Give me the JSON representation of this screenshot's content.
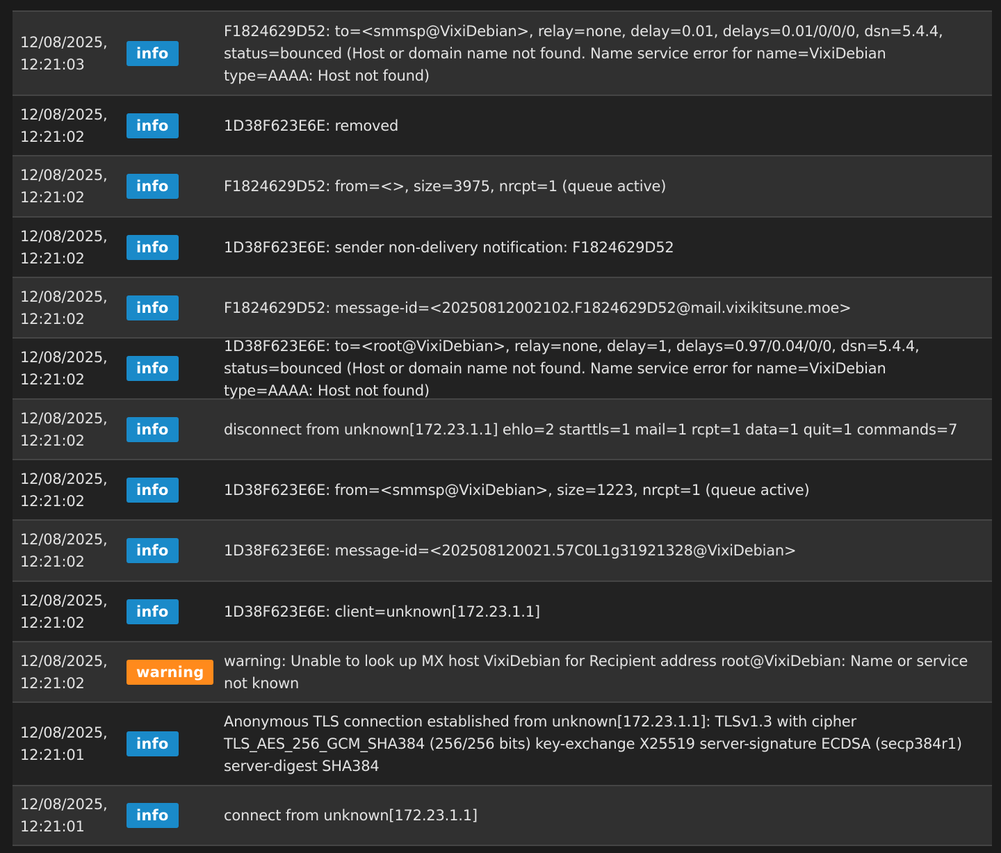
{
  "colors": {
    "info_badge": "#1a8ac9",
    "warning_badge": "#ff8a1c",
    "row_odd": "#303030",
    "row_even": "#222222",
    "text": "#e3e3e3"
  },
  "log": {
    "rows": [
      {
        "date": "12/08/2025,",
        "time": "12:21:03",
        "level": "info",
        "message": "F1824629D52: to=<smmsp@VixiDebian>, relay=none, delay=0.01, delays=0.01/0/0/0, dsn=5.4.4, status=bounced (Host or domain name not found. Name service error for name=VixiDebian type=AAAA: Host not found)"
      },
      {
        "date": "12/08/2025,",
        "time": "12:21:02",
        "level": "info",
        "message": "1D38F623E6E: removed"
      },
      {
        "date": "12/08/2025,",
        "time": "12:21:02",
        "level": "info",
        "message": "F1824629D52: from=<>, size=3975, nrcpt=1 (queue active)"
      },
      {
        "date": "12/08/2025,",
        "time": "12:21:02",
        "level": "info",
        "message": "1D38F623E6E: sender non-delivery notification: F1824629D52"
      },
      {
        "date": "12/08/2025,",
        "time": "12:21:02",
        "level": "info",
        "message": "F1824629D52: message-id=<20250812002102.F1824629D52@mail.vixikitsune.moe>"
      },
      {
        "date": "12/08/2025,",
        "time": "12:21:02",
        "level": "info",
        "message": "1D38F623E6E: to=<root@VixiDebian>, relay=none, delay=1, delays=0.97/0.04/0/0, dsn=5.4.4, status=bounced (Host or domain name not found. Name service error for name=VixiDebian type=AAAA: Host not found)"
      },
      {
        "date": "12/08/2025,",
        "time": "12:21:02",
        "level": "info",
        "message": "disconnect from unknown[172.23.1.1] ehlo=2 starttls=1 mail=1 rcpt=1 data=1 quit=1 commands=7"
      },
      {
        "date": "12/08/2025,",
        "time": "12:21:02",
        "level": "info",
        "message": "1D38F623E6E: from=<smmsp@VixiDebian>, size=1223, nrcpt=1 (queue active)"
      },
      {
        "date": "12/08/2025,",
        "time": "12:21:02",
        "level": "info",
        "message": "1D38F623E6E: message-id=<202508120021.57C0L1g31921328@VixiDebian>"
      },
      {
        "date": "12/08/2025,",
        "time": "12:21:02",
        "level": "info",
        "message": "1D38F623E6E: client=unknown[172.23.1.1]"
      },
      {
        "date": "12/08/2025,",
        "time": "12:21:02",
        "level": "warning",
        "message": "warning: Unable to look up MX host VixiDebian for Recipient address root@VixiDebian: Name or service not known"
      },
      {
        "date": "12/08/2025,",
        "time": "12:21:01",
        "level": "info",
        "message": "Anonymous TLS connection established from unknown[172.23.1.1]: TLSv1.3 with cipher TLS_AES_256_GCM_SHA384 (256/256 bits) key-exchange X25519 server-signature ECDSA (secp384r1) server-digest SHA384"
      },
      {
        "date": "12/08/2025,",
        "time": "12:21:01",
        "level": "info",
        "message": "connect from unknown[172.23.1.1]"
      }
    ]
  }
}
